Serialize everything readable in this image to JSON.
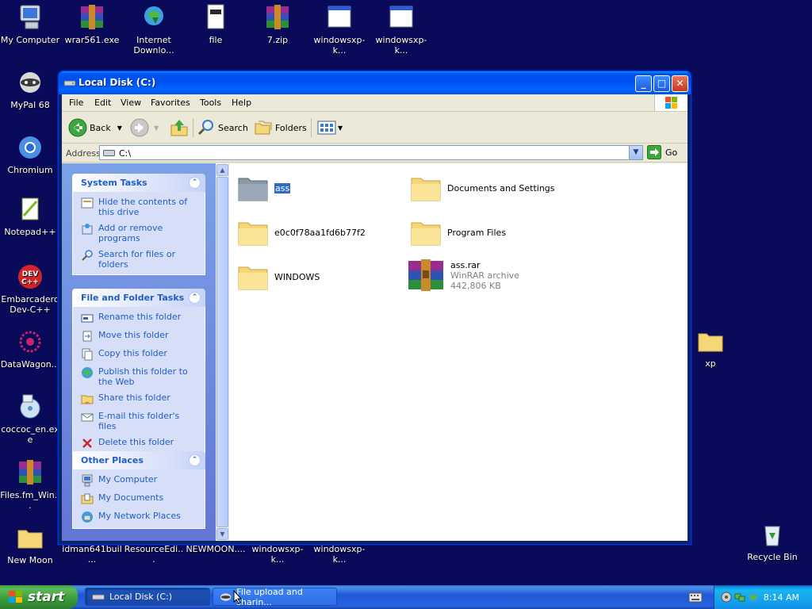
{
  "desktop": {
    "icons": [
      {
        "label": "My Computer"
      },
      {
        "label": "wrar561.exe"
      },
      {
        "label": "Internet Downlo..."
      },
      {
        "label": "file"
      },
      {
        "label": "7.zip"
      },
      {
        "label": "windowsxp-k..."
      },
      {
        "label": "windowsxp-k..."
      },
      {
        "label": "MyPal 68"
      },
      {
        "label": "Chromium"
      },
      {
        "label": "Notepad++"
      },
      {
        "label": "Embarcadero Dev-C++"
      },
      {
        "label": "DataWagon..."
      },
      {
        "label": "coccoc_en.exe"
      },
      {
        "label": "Files.fm_Win..."
      },
      {
        "label": "New Moon"
      },
      {
        "label": "idman641buil..."
      },
      {
        "label": "ResourceEdi..."
      },
      {
        "label": "NEWMOON...."
      },
      {
        "label": "windowsxp-k..."
      },
      {
        "label": "windowsxp-k..."
      },
      {
        "label": "xp"
      },
      {
        "label": "Recycle Bin"
      }
    ]
  },
  "window": {
    "title": "Local Disk (C:)",
    "controls": {
      "minimize": "_",
      "maximize": "□",
      "close": "✕"
    },
    "menu": [
      "File",
      "Edit",
      "View",
      "Favorites",
      "Tools",
      "Help"
    ],
    "toolbar": {
      "back": "Back",
      "search": "Search",
      "folders": "Folders"
    },
    "address": {
      "label": "Address",
      "value": "C:\\",
      "go": "Go"
    },
    "taskpane": {
      "system_tasks": {
        "title": "System Tasks",
        "items": [
          "Hide the contents of this drive",
          "Add or remove programs",
          "Search for files or folders"
        ]
      },
      "file_folder_tasks": {
        "title": "File and Folder Tasks",
        "items": [
          "Rename this folder",
          "Move this folder",
          "Copy this folder",
          "Publish this folder to the Web",
          "Share this folder",
          "E-mail this folder's files",
          "Delete this folder"
        ]
      },
      "other_places": {
        "title": "Other Places",
        "items": [
          "My Computer",
          "My Documents",
          "My Network Places"
        ]
      }
    },
    "files": [
      {
        "name": "ass",
        "type": "folder",
        "selected": true
      },
      {
        "name": "Documents and Settings",
        "type": "folder"
      },
      {
        "name": "e0c0f78aa1fd6b77f2",
        "type": "folder"
      },
      {
        "name": "Program Files",
        "type": "folder"
      },
      {
        "name": "WINDOWS",
        "type": "folder"
      },
      {
        "name": "ass.rar",
        "type": "winrar",
        "subtitle": "WinRAR archive",
        "size": "442,806 KB"
      }
    ]
  },
  "taskbar": {
    "start": "start",
    "tasks": [
      {
        "label": "Local Disk (C:)",
        "active": true
      },
      {
        "label": "File upload and sharin..."
      }
    ],
    "clock": "8:14 AM"
  },
  "colors": {
    "desktop_bg": "#0a0a5a",
    "titlebar": "#0053ee",
    "taskpane_link": "#215dc6",
    "selection": "#316ac5"
  }
}
